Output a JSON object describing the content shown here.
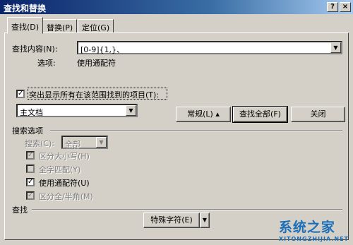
{
  "window": {
    "title": "查找和替换"
  },
  "tabs": [
    {
      "label": "查找(D)"
    },
    {
      "label": "替换(P)"
    },
    {
      "label": "定位(G)"
    }
  ],
  "find": {
    "label": "查找内容(N):",
    "value": "[0-9]{1,}、",
    "options_label": "选项:",
    "options_value": "使用通配符"
  },
  "highlight": {
    "label": "突出显示所有在该范围找到的项目(T):",
    "checked": true,
    "scope_value": "主文档"
  },
  "buttons": {
    "normal": "常规(L) ▴",
    "find_all": "查找全部(F)",
    "close": "关闭"
  },
  "search_options": {
    "section_label": "搜索选项",
    "search_label": "搜索(C):",
    "search_value": "全部",
    "checkboxes": [
      {
        "label": "区分大小写(H)",
        "checked": true,
        "enabled": false
      },
      {
        "label": "全字匹配(Y)",
        "checked": false,
        "enabled": false
      },
      {
        "label": "使用通配符(U)",
        "checked": true,
        "enabled": true
      },
      {
        "label": "区分全/半角(M)",
        "checked": true,
        "enabled": false
      }
    ]
  },
  "find_section": {
    "label": "查找",
    "special_button": "特殊字符(E)"
  },
  "watermark": {
    "main": "系统之家",
    "sub": "XITONGZHIJIA.NET"
  }
}
